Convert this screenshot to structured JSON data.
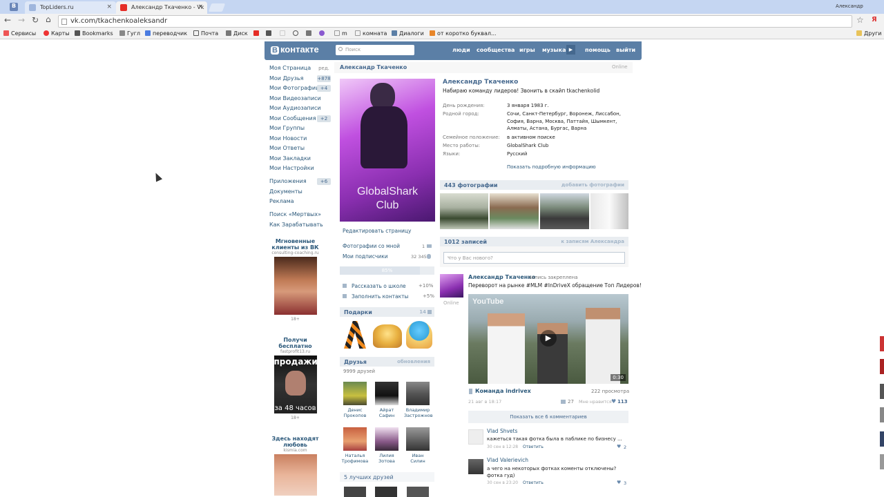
{
  "browser": {
    "tabs": [
      {
        "label": "TopLiders.ru",
        "close": "×"
      },
      {
        "label": "Александр Ткаченко - Vk",
        "close": "×"
      }
    ],
    "profile_name": "Александр",
    "url": "vk.com/tkachenkoaleksandr",
    "bookmarks": [
      "Сервисы",
      "Карты",
      "Bookmarks",
      "Гугл",
      "переводчик",
      "Почта",
      "Диск",
      "m",
      "комната",
      "Диалоги",
      "от коротко буквал...",
      "Други"
    ]
  },
  "vk": {
    "logo": "контакте",
    "logo_b": "B",
    "search_placeholder": "Поиск",
    "nav": [
      "люди",
      "сообщества",
      "игры",
      "музыка",
      "помощь",
      "выйти"
    ],
    "menu": [
      {
        "label": "Моя Страница",
        "badge": "ред."
      },
      {
        "label": "Мои Друзья",
        "badge": "+878"
      },
      {
        "label": "Мои Фотографии",
        "badge": "+4"
      },
      {
        "label": "Мои Видеозаписи",
        "badge": ""
      },
      {
        "label": "Мои Аудиозаписи",
        "badge": ""
      },
      {
        "label": "Мои Сообщения",
        "badge": "+2"
      },
      {
        "label": "Мои Группы",
        "badge": ""
      },
      {
        "label": "Мои Новости",
        "badge": ""
      },
      {
        "label": "Мои Ответы",
        "badge": ""
      },
      {
        "label": "Мои Закладки",
        "badge": ""
      },
      {
        "label": "Мои Настройки",
        "badge": ""
      }
    ],
    "menu2": [
      {
        "label": "Приложения",
        "badge": "+6"
      },
      {
        "label": "Документы",
        "badge": ""
      },
      {
        "label": "Реклама",
        "badge": ""
      }
    ],
    "menu3": [
      "Поиск «Мертвых»",
      "Как Зарабатывать"
    ],
    "ads": [
      {
        "title": "Мгновенные клиенты из ВК",
        "site": "consulting-coaching.ru",
        "age": "18+"
      },
      {
        "title": "Получи бесплатно",
        "site": "fastprofit13.ru",
        "age": "18+",
        "img_text1": "продажи",
        "img_text2": "за 48 часов"
      },
      {
        "title": "Здесь находят любовь",
        "site": "kismia.com"
      }
    ],
    "profile": {
      "header_name": "Александр Ткаченко",
      "online": "Online",
      "name": "Александр Ткаченко",
      "status": "Набираю команду лидеров! Звонить в скайп tkachenkolid",
      "photo_text": "GlobalShark Club",
      "fields": [
        {
          "label": "День рождения:",
          "value": "3 января 1983 г."
        },
        {
          "label": "Родной город:",
          "value": "Сочи, Санкт-Петербург, Воронеж, Лиссабон, София, Варна, Москва, Паттайя, Шымкент, Алматы, Астана, Бургас, Варна"
        },
        {
          "label": "Семейное положение:",
          "value": "в активном поиске"
        },
        {
          "label": "Место работы:",
          "value": "GlobalShark Club"
        },
        {
          "label": "Языки:",
          "value": "Русский"
        }
      ],
      "more_info": "Показать подробную информацию",
      "edit_page": "Редактировать страницу",
      "photos_with_me": "Фотографии со мной",
      "photos_with_me_count": "1",
      "subscribers": "Мои подписчики",
      "subscribers_count": "32 345",
      "progress_label": "85%",
      "progress": 0.85,
      "school": "Рассказать о школе",
      "school_pct": "+10%",
      "contacts": "Заполнить контакты",
      "contacts_pct": "+5%",
      "gifts_title": "Подарки",
      "gifts_count": "14",
      "friends_title": "Друзья",
      "friends_updates": "обновления",
      "friends_count": "9999 друзей",
      "friends": [
        {
          "first": "Денис",
          "last": "Прокопов"
        },
        {
          "first": "Айрат",
          "last": "Сафин"
        },
        {
          "first": "Владимир",
          "last": "Застрожнов"
        },
        {
          "first": "Наталья",
          "last": "Трофимова"
        },
        {
          "first": "Лилия",
          "last": "Зотова"
        },
        {
          "first": "Иван",
          "last": "Силин"
        }
      ],
      "best_friends": "5 лучших друзей",
      "photos_title": "443 фотографии",
      "photos_add": "добавить фотографии",
      "posts_title": "1012 записей",
      "posts_link": "к записям Александра",
      "post_placeholder": "Что у Вас нового?",
      "post": {
        "author": "Александр Ткаченко",
        "pinned": "запись закреплена",
        "text": "Переворот на рынке #MLM #InDriveX обращение Топ Лидеров!",
        "online": "Online",
        "youtube": "YouTube",
        "duration": "0:30",
        "video_title": "Команда indrivex",
        "views": "222 просмотра",
        "date": "21 авг в 18:17",
        "comments": "27",
        "likes_label": "Мне нравится",
        "likes": "113",
        "show_comments": "Показать все 6 комментариев"
      },
      "comments": [
        {
          "author": "Vlad Shvets",
          "text": "кажеться такая фотка была в паблике по бизнесу ...",
          "date": "30 сен в 12:28",
          "reply": "Ответить",
          "likes": "2"
        },
        {
          "author": "Vlad Valerievich",
          "text": "а чего на некоторых фотках коменты отключены? фотка гуд)",
          "date": "30 сен в 23:20",
          "reply": "Ответить",
          "likes": "3"
        }
      ]
    }
  }
}
